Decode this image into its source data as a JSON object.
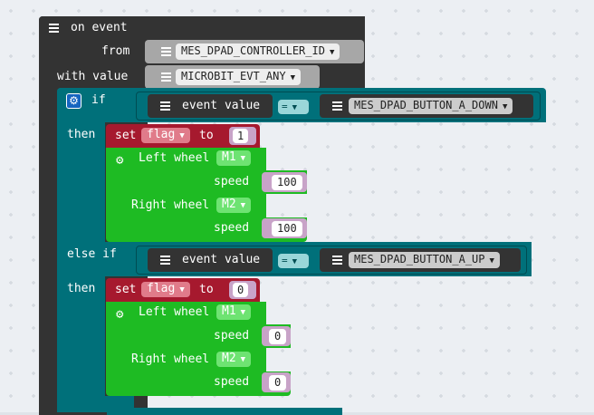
{
  "colors": {
    "event_block": "#333333",
    "if_block": "#00707a",
    "set_block": "#a6192e",
    "motor_block": "#1ebb23",
    "number_shadow": "#c8a3c8",
    "enum_block": "#a7a7a7"
  },
  "event_block": {
    "title": "on event",
    "from_label": "from",
    "from_value": "MES_DPAD_CONTROLLER_ID",
    "with_value_label": "with value",
    "with_value_value": "MICROBIT_EVT_ANY"
  },
  "if_block": {
    "if_label": "if",
    "then_label": "then",
    "else_if_label": "else if",
    "gear_icon": "gear-icon"
  },
  "condition1": {
    "left_label": "event value",
    "operator": "=",
    "right_value": "MES_DPAD_BUTTON_A_DOWN"
  },
  "condition2": {
    "left_label": "event value",
    "operator": "=",
    "right_value": "MES_DPAD_BUTTON_A_UP"
  },
  "branch1": {
    "set_label": "set",
    "variable": "flag",
    "to_label": "to",
    "value": "1",
    "left_wheel_label": "Left wheel",
    "left_motor": "M1",
    "left_speed_label": "speed",
    "left_speed": "100",
    "right_wheel_label": "Right wheel",
    "right_motor": "M2",
    "right_speed_label": "speed",
    "right_speed": "100"
  },
  "branch2": {
    "set_label": "set",
    "variable": "flag",
    "to_label": "to",
    "value": "0",
    "left_wheel_label": "Left wheel",
    "left_motor": "M1",
    "left_speed_label": "speed",
    "left_speed": "0",
    "right_wheel_label": "Right wheel",
    "right_motor": "M2",
    "right_speed_label": "speed",
    "right_speed": "0"
  }
}
